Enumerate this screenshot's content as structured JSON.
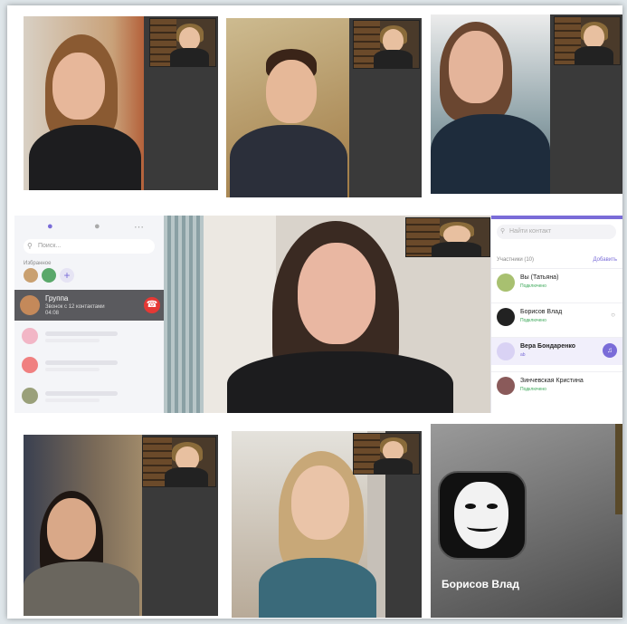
{
  "app": {
    "search_placeholder": "Поиск...",
    "favorites_label": "Избранное",
    "call": {
      "title": "Группа",
      "subtitle": "Звонок с 12 контактами",
      "timer": "04:08"
    }
  },
  "participants_panel": {
    "search_placeholder": "Найти контакт",
    "header": "Участники (10)",
    "add_label": "Добавить",
    "members": [
      {
        "name": "Вы (Татьяна)",
        "status": "Подключено"
      },
      {
        "name": "Борисов Влад",
        "status": "Подключено"
      },
      {
        "name": "Вера Бондаренко",
        "status": "ab"
      },
      {
        "name": "Зинчевская Кристина",
        "status": "Подключено"
      }
    ]
  },
  "anon_tile": {
    "name": "Борисов Влад"
  },
  "icons": {
    "chat": "chat-bubble-icon",
    "calls": "phone-icon",
    "more": "more-dots-icon",
    "search": "search-icon",
    "hangup": "hangup-icon",
    "mic": "microphone-icon"
  },
  "colors": {
    "accent": "#7a6cd8",
    "hangup": "#e53935",
    "connected": "#3aa757"
  }
}
